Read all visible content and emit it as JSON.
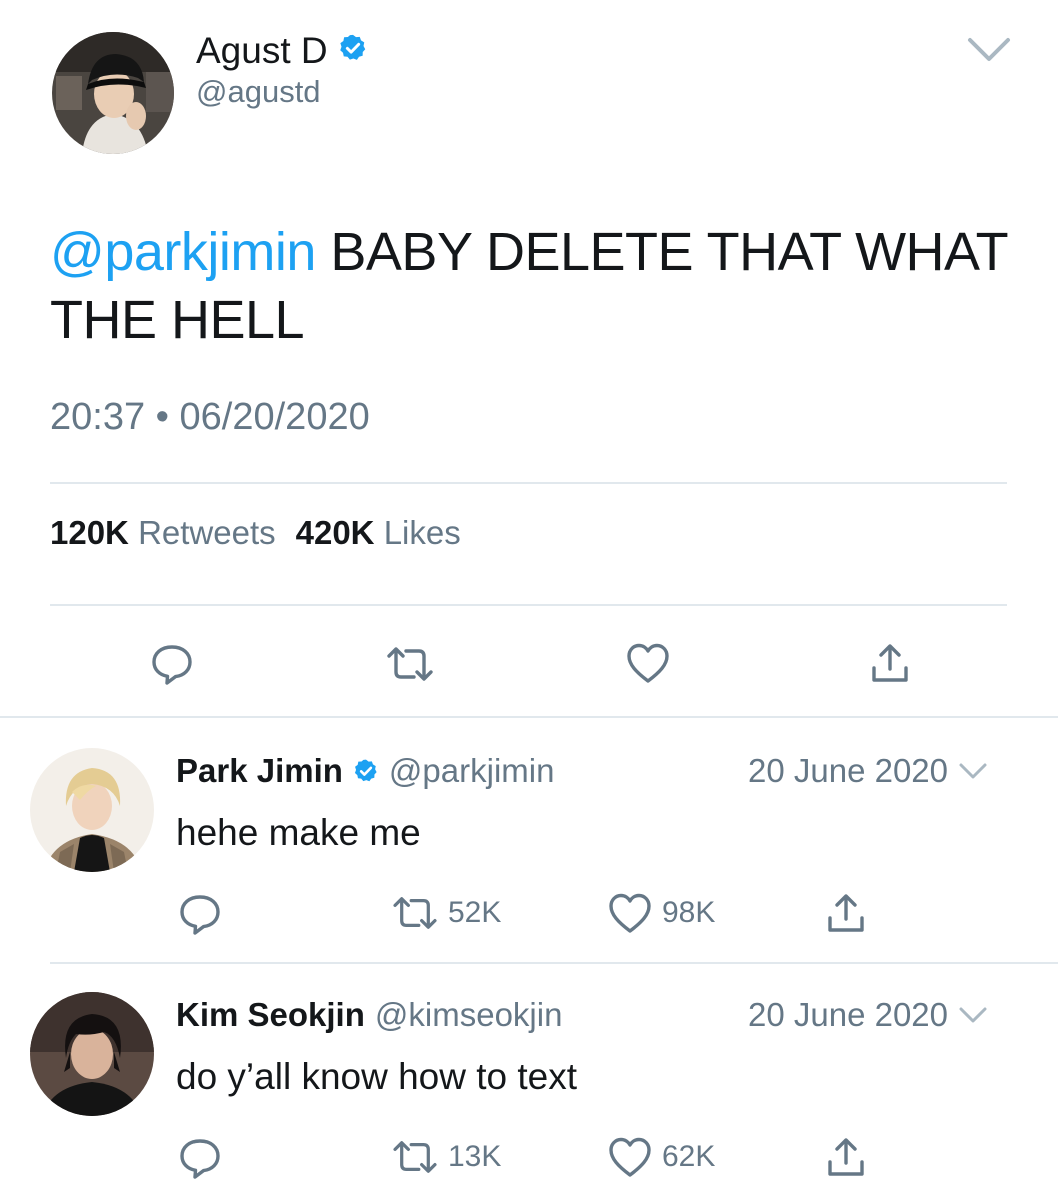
{
  "main_tweet": {
    "author": {
      "display_name": "Agust D",
      "handle": "@agustd",
      "verified": true
    },
    "text": {
      "mention": "@parkjimin",
      "body": "BABY DELETE THAT WHAT THE HELL"
    },
    "time": "20:37",
    "separator": "•",
    "date": "06/20/2020",
    "stats": {
      "retweets_count": "120K",
      "retweets_label": "Retweets",
      "likes_count": "420K",
      "likes_label": "Likes"
    },
    "actions": [
      "reply-icon",
      "retweet-icon",
      "like-icon",
      "share-icon"
    ]
  },
  "replies": [
    {
      "display_name": "Park Jimin",
      "verified": true,
      "handle": "@parkjimin",
      "date": "20 June 2020",
      "text": "hehe make me",
      "retweets": "52K",
      "likes": "98K"
    },
    {
      "display_name": "Kim Seokjin",
      "verified": false,
      "handle": "@kimseokjin",
      "date": "20 June 2020",
      "text": "do y’all know how to text",
      "retweets": "13K",
      "likes": "62K"
    }
  ],
  "colors": {
    "accent": "#1da1f2",
    "text_primary": "#14171a",
    "text_secondary": "#657786",
    "divider": "#e1e8ed"
  }
}
